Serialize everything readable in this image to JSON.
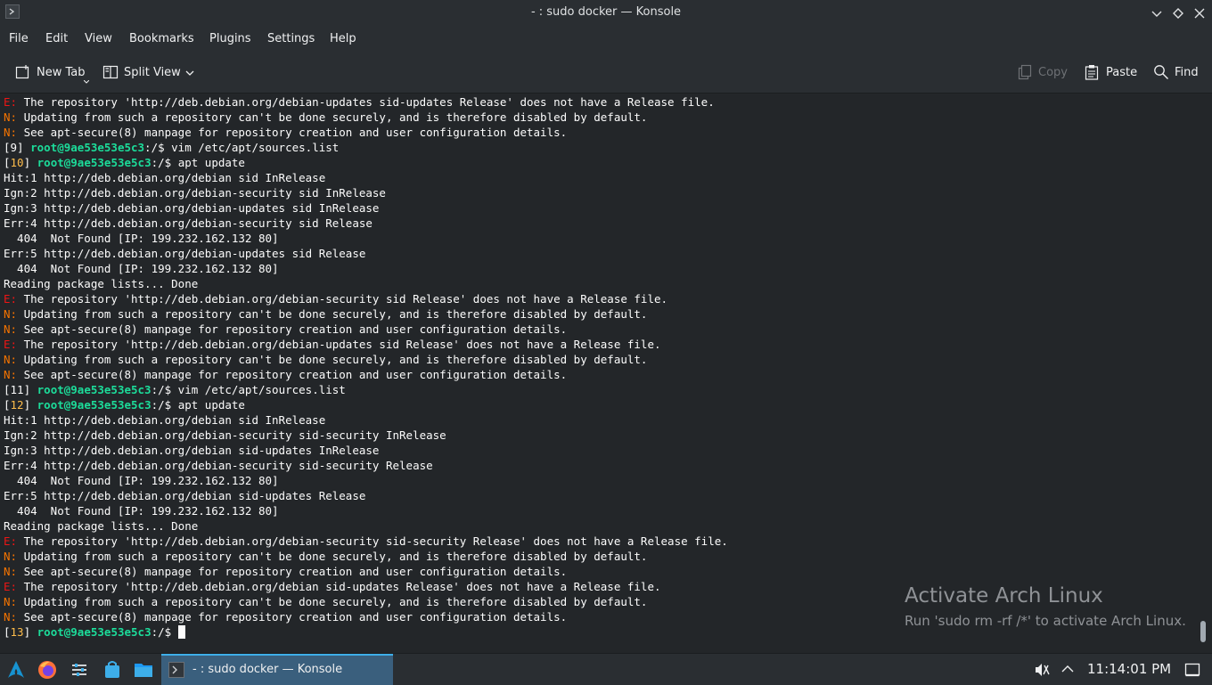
{
  "window": {
    "title": "- : sudo docker — Konsole"
  },
  "menu": [
    "File",
    "Edit",
    "View",
    "Bookmarks",
    "Plugins",
    "Settings",
    "Help"
  ],
  "toolbar": {
    "new_tab": "New Tab",
    "split_view": "Split View",
    "copy": "Copy",
    "paste": "Paste",
    "find": "Find"
  },
  "terminal": {
    "lines": [
      [
        {
          "t": "E: ",
          "c": "red"
        },
        {
          "t": "The repository 'http://deb.debian.org/debian-updates sid-updates Release' does not have a Release file."
        }
      ],
      [
        {
          "t": "N: ",
          "c": "orange"
        },
        {
          "t": "Updating from such a repository can't be done securely, and is therefore disabled by default."
        }
      ],
      [
        {
          "t": "N: ",
          "c": "orange"
        },
        {
          "t": "See apt-secure(8) manpage for repository creation and user configuration details."
        }
      ],
      [
        {
          "t": "[9] "
        },
        {
          "t": "root@9ae53e53e5c3",
          "c": "green"
        },
        {
          "t": ":/$ vim /etc/apt/sources.list"
        }
      ],
      [
        {
          "t": "["
        },
        {
          "t": "10",
          "c": "yellow"
        },
        {
          "t": "] "
        },
        {
          "t": "root@9ae53e53e5c3",
          "c": "green"
        },
        {
          "t": ":/$ apt update"
        }
      ],
      [
        {
          "t": "Hit:1 http://deb.debian.org/debian sid InRelease"
        }
      ],
      [
        {
          "t": "Ign:2 http://deb.debian.org/debian-security sid InRelease"
        }
      ],
      [
        {
          "t": "Ign:3 http://deb.debian.org/debian-updates sid InRelease"
        }
      ],
      [
        {
          "t": "Err:4 http://deb.debian.org/debian-security sid Release"
        }
      ],
      [
        {
          "t": "  404  Not Found [IP: 199.232.162.132 80]"
        }
      ],
      [
        {
          "t": "Err:5 http://deb.debian.org/debian-updates sid Release"
        }
      ],
      [
        {
          "t": "  404  Not Found [IP: 199.232.162.132 80]"
        }
      ],
      [
        {
          "t": "Reading package lists... Done"
        }
      ],
      [
        {
          "t": "E: ",
          "c": "red"
        },
        {
          "t": "The repository 'http://deb.debian.org/debian-security sid Release' does not have a Release file."
        }
      ],
      [
        {
          "t": "N: ",
          "c": "orange"
        },
        {
          "t": "Updating from such a repository can't be done securely, and is therefore disabled by default."
        }
      ],
      [
        {
          "t": "N: ",
          "c": "orange"
        },
        {
          "t": "See apt-secure(8) manpage for repository creation and user configuration details."
        }
      ],
      [
        {
          "t": "E: ",
          "c": "red"
        },
        {
          "t": "The repository 'http://deb.debian.org/debian-updates sid Release' does not have a Release file."
        }
      ],
      [
        {
          "t": "N: ",
          "c": "orange"
        },
        {
          "t": "Updating from such a repository can't be done securely, and is therefore disabled by default."
        }
      ],
      [
        {
          "t": "N: ",
          "c": "orange"
        },
        {
          "t": "See apt-secure(8) manpage for repository creation and user configuration details."
        }
      ],
      [
        {
          "t": "[11] "
        },
        {
          "t": "root@9ae53e53e5c3",
          "c": "green"
        },
        {
          "t": ":/$ vim /etc/apt/sources.list"
        }
      ],
      [
        {
          "t": "["
        },
        {
          "t": "12",
          "c": "yellow"
        },
        {
          "t": "] "
        },
        {
          "t": "root@9ae53e53e5c3",
          "c": "green"
        },
        {
          "t": ":/$ apt update"
        }
      ],
      [
        {
          "t": "Hit:1 http://deb.debian.org/debian sid InRelease"
        }
      ],
      [
        {
          "t": "Ign:2 http://deb.debian.org/debian-security sid-security InRelease"
        }
      ],
      [
        {
          "t": "Ign:3 http://deb.debian.org/debian sid-updates InRelease"
        }
      ],
      [
        {
          "t": "Err:4 http://deb.debian.org/debian-security sid-security Release"
        }
      ],
      [
        {
          "t": "  404  Not Found [IP: 199.232.162.132 80]"
        }
      ],
      [
        {
          "t": "Err:5 http://deb.debian.org/debian sid-updates Release"
        }
      ],
      [
        {
          "t": "  404  Not Found [IP: 199.232.162.132 80]"
        }
      ],
      [
        {
          "t": "Reading package lists... Done"
        }
      ],
      [
        {
          "t": "E: ",
          "c": "red"
        },
        {
          "t": "The repository 'http://deb.debian.org/debian-security sid-security Release' does not have a Release file."
        }
      ],
      [
        {
          "t": "N: ",
          "c": "orange"
        },
        {
          "t": "Updating from such a repository can't be done securely, and is therefore disabled by default."
        }
      ],
      [
        {
          "t": "N: ",
          "c": "orange"
        },
        {
          "t": "See apt-secure(8) manpage for repository creation and user configuration details."
        }
      ],
      [
        {
          "t": "E: ",
          "c": "red"
        },
        {
          "t": "The repository 'http://deb.debian.org/debian sid-updates Release' does not have a Release file."
        }
      ],
      [
        {
          "t": "N: ",
          "c": "orange"
        },
        {
          "t": "Updating from such a repository can't be done securely, and is therefore disabled by default."
        }
      ],
      [
        {
          "t": "N: ",
          "c": "orange"
        },
        {
          "t": "See apt-secure(8) manpage for repository creation and user configuration details."
        }
      ],
      [
        {
          "t": "["
        },
        {
          "t": "13",
          "c": "yellow"
        },
        {
          "t": "] "
        },
        {
          "t": "root@9ae53e53e5c3",
          "c": "green"
        },
        {
          "t": ":/$ "
        }
      ]
    ]
  },
  "watermark": {
    "title": "Activate Arch Linux",
    "subtitle": "Run 'sudo rm -rf /*' to activate Arch Linux."
  },
  "taskbar": {
    "launchers": [
      "arch-launcher-icon",
      "firefox-icon",
      "system-settings-icon",
      "discover-store-icon",
      "file-manager-icon"
    ],
    "task_label": "- : sudo docker — Konsole",
    "clock": "11:14:01 PM"
  },
  "colors": {
    "accent": "#3daee9",
    "error": "#ed1515",
    "notice": "#f67400",
    "prompt_user": "#1cdc9a",
    "prompt_number": "#fdbc4b",
    "background": "#232629"
  }
}
